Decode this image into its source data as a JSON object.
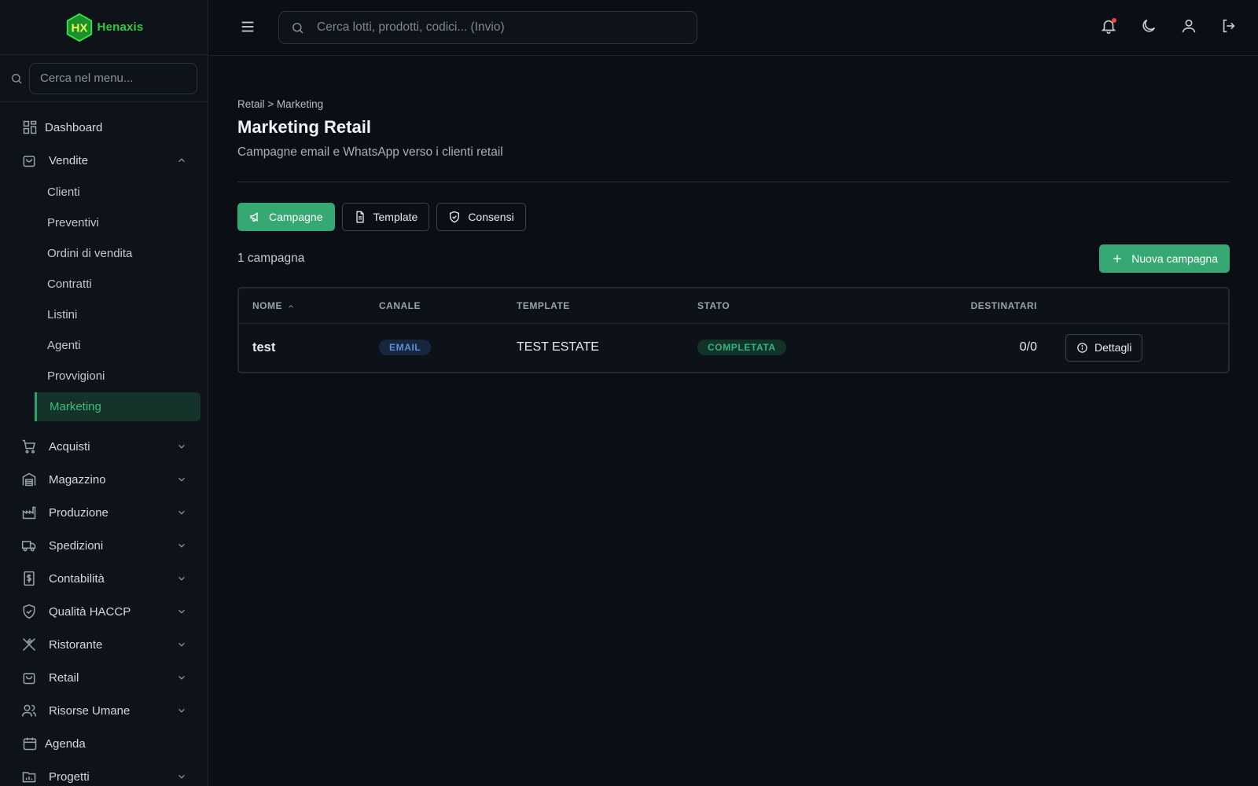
{
  "brand": {
    "name": "Henaxis",
    "logo_letters": "HX",
    "accent": "#2ecc40"
  },
  "topbar": {
    "search_placeholder": "Cerca lotti, prodotti, codici... (Invio)",
    "icons": [
      "menu-icon",
      "bell-icon",
      "moon-icon",
      "user-icon",
      "logout-icon"
    ]
  },
  "sidebar": {
    "search_placeholder": "Cerca nel menu...",
    "items": {
      "dashboard": "Dashboard",
      "vendite": "Vendite",
      "vendite_sub": {
        "clienti": "Clienti",
        "preventivi": "Preventivi",
        "ordini": "Ordini di vendita",
        "contratti": "Contratti",
        "listini": "Listini",
        "agenti": "Agenti",
        "provvigioni": "Provvigioni",
        "marketing": "Marketing"
      },
      "acquisti": "Acquisti",
      "magazzino": "Magazzino",
      "produzione": "Produzione",
      "spedizioni": "Spedizioni",
      "contabilita": "Contabilità",
      "qualita": "Qualità HACCP",
      "ristorante": "Ristorante",
      "retail": "Retail",
      "risorse_umane": "Risorse Umane",
      "agenda": "Agenda",
      "progetti": "Progetti"
    }
  },
  "page": {
    "breadcrumb": "Retail > Marketing",
    "title": "Marketing Retail",
    "subtitle": "Campagne email e WhatsApp verso i clienti retail"
  },
  "tabs": {
    "campagne": "Campagne",
    "template": "Template",
    "consensi": "Consensi"
  },
  "list": {
    "count": "1 campagna",
    "new_button": "Nuova campagna",
    "columns": {
      "nome": "NOME",
      "canale": "CANALE",
      "template": "TEMPLATE",
      "stato": "STATO",
      "destinatari": "DESTINATARI"
    },
    "rows": [
      {
        "nome": "test",
        "canale": "EMAIL",
        "template": "TEST ESTATE",
        "stato": "COMPLETATA",
        "destinatari": "0/0",
        "action": "Dettagli"
      }
    ]
  },
  "colors": {
    "primary": "#36a874",
    "background": "#0b0f15",
    "sidebar": "#0e1319"
  }
}
